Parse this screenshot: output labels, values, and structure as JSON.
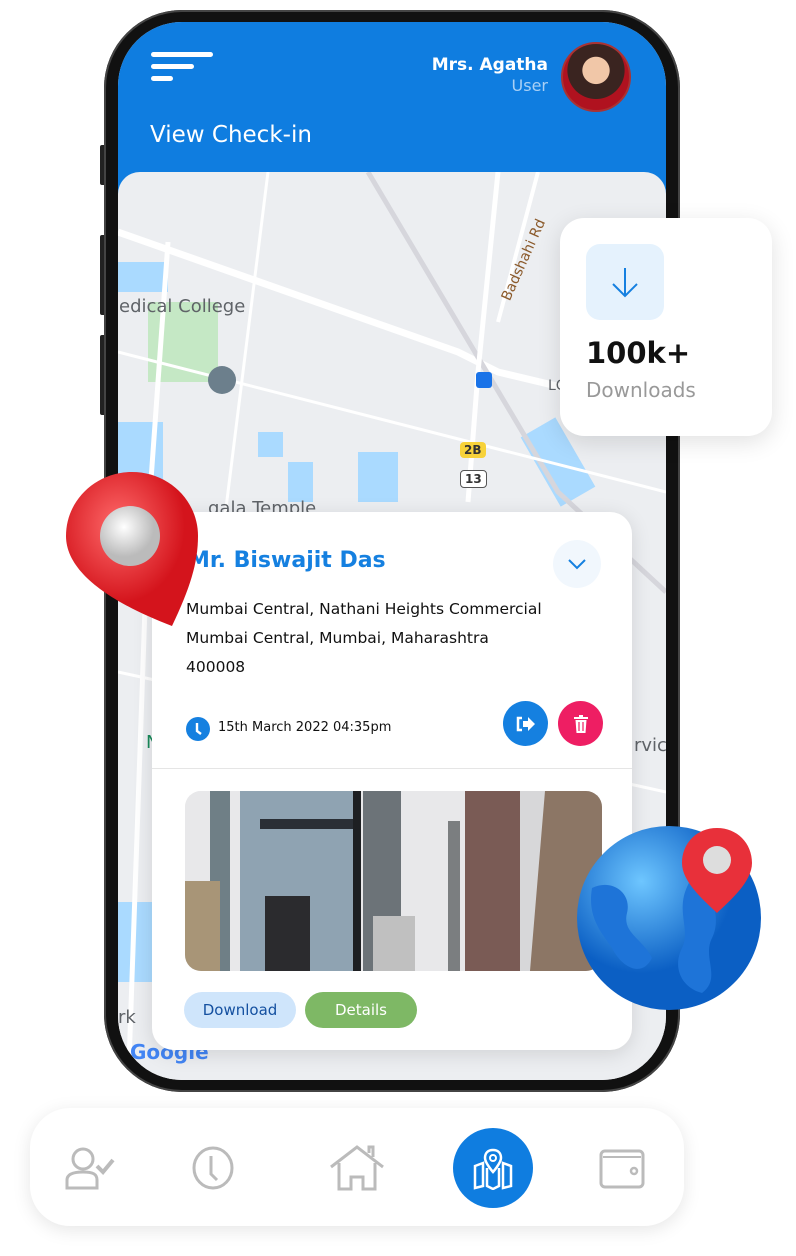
{
  "header": {
    "user_name": "Mrs. Agatha",
    "user_role": "User",
    "page_title": "View Check-in"
  },
  "map": {
    "labels": [
      "ledical College",
      "Badshahi Rd",
      "LC",
      "gala Temple",
      "rvice",
      "rk",
      "N"
    ],
    "shields": [
      "2B",
      "13"
    ],
    "attribution": "Google"
  },
  "checkin": {
    "name": "Mr. Biswajit Das",
    "address_lines": [
      "Mumbai Central, Nathani Heights Commercial",
      "Mumbai Central, Mumbai, Maharashtra",
      "400008"
    ],
    "datetime": "15th March 2022  04:35pm",
    "download_label": "Download",
    "details_label": "Details"
  },
  "downloads": {
    "count": "100k+",
    "label": "Downloads"
  },
  "bottom_nav": {
    "items": [
      "attendance-icon",
      "clock-icon",
      "home-icon",
      "map-icon",
      "wallet-icon"
    ],
    "active": "map-icon"
  },
  "colors": {
    "primary": "#0f7de0",
    "danger": "#ee1e63",
    "success": "#7eb865",
    "download_bg": "#cfe5fb"
  }
}
